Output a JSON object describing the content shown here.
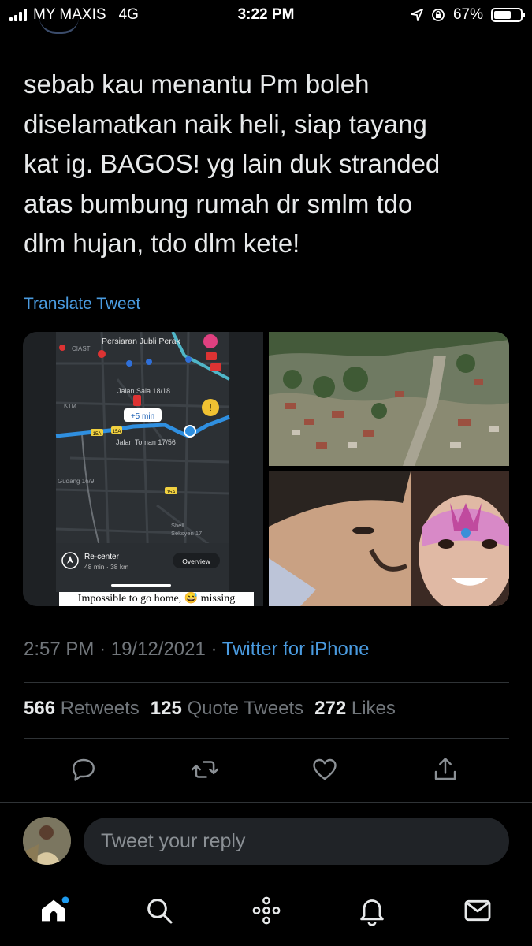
{
  "status_bar": {
    "carrier": "MY MAXIS",
    "network": "4G",
    "time": "3:22 PM",
    "battery": "67%",
    "battery_level": 0.67
  },
  "tweet": {
    "text": "sebab kau menantu Pm boleh\ndiselamatkan naik heli, siap tayang\nkat ig. BAGOS! yg lain duk stranded\natas bumbung rumah dr smlm tdo\ndlm hujan, tdo dlm kete!",
    "translate_label": "Translate Tweet",
    "time": "2:57 PM",
    "date": "19/12/2021",
    "source": "Twitter for iPhone",
    "separator": "·"
  },
  "media": {
    "map": {
      "top_label": "Persiaran Jubli Perak",
      "ciast_label": "CIAST",
      "road_1": "Jalan Sala 18/18",
      "road_2": "Jalan Toman 17/56",
      "ktm_label": "KTM",
      "gudang_label": "Gudang 16/9",
      "shell_label": "Shell\nSeksyen 17",
      "delay_badge": "+5 min",
      "route_badge_1": "15A",
      "route_badge_2": "15A",
      "route_badge_3": "15A",
      "recenter_label": "Re-center",
      "trip_info": "48 min · 38 km",
      "overview_label": "Overview",
      "caption": "Impossible to go home, 😅 missing"
    }
  },
  "stats": {
    "retweets_count": "566",
    "retweets_label": "Retweets",
    "quotes_count": "125",
    "quotes_label": "Quote Tweets",
    "likes_count": "272",
    "likes_label": "Likes"
  },
  "reply": {
    "placeholder": "Tweet your reply"
  },
  "icons": {
    "reply": "reply-icon",
    "retweet": "retweet-icon",
    "like": "heart-icon",
    "share": "share-icon",
    "home": "home-icon",
    "search": "search-icon",
    "spaces": "spaces-icon",
    "notifications": "bell-icon",
    "messages": "mail-icon"
  },
  "colors": {
    "background": "#000000",
    "accent": "#1d9bf0",
    "text": "#e7e9ea",
    "muted": "#71767b"
  }
}
